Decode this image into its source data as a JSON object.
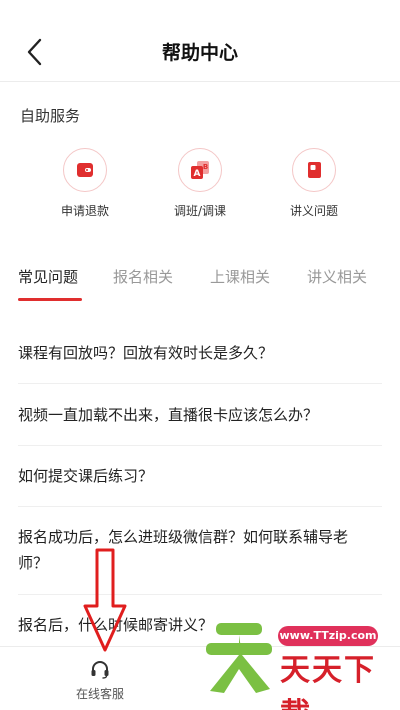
{
  "header": {
    "title": "帮助中心"
  },
  "self_service": {
    "title": "自助服务",
    "items": [
      {
        "label": "申请退款",
        "icon": "wallet-icon"
      },
      {
        "label": "调班/调课",
        "icon": "swap-ab-icon"
      },
      {
        "label": "讲义问题",
        "icon": "book-icon"
      }
    ]
  },
  "tabs": [
    "常见问题",
    "报名相关",
    "上课相关",
    "讲义相关"
  ],
  "faq": [
    "课程有回放吗？回放有效时长是多久？",
    "视频一直加载不出来，直播很卡应该怎么办？",
    "如何提交课后练习？",
    "报名成功后，怎么进班级微信群？如何联系辅导老师？",
    "报名后，什么时候邮寄讲义？"
  ],
  "bottom": {
    "customer_service": "在线客服"
  },
  "watermark": {
    "url": "www.TTzip.com",
    "text": "天天下載"
  },
  "colors": {
    "accent": "#e02e2e",
    "icon_border": "#f4c7c7"
  }
}
